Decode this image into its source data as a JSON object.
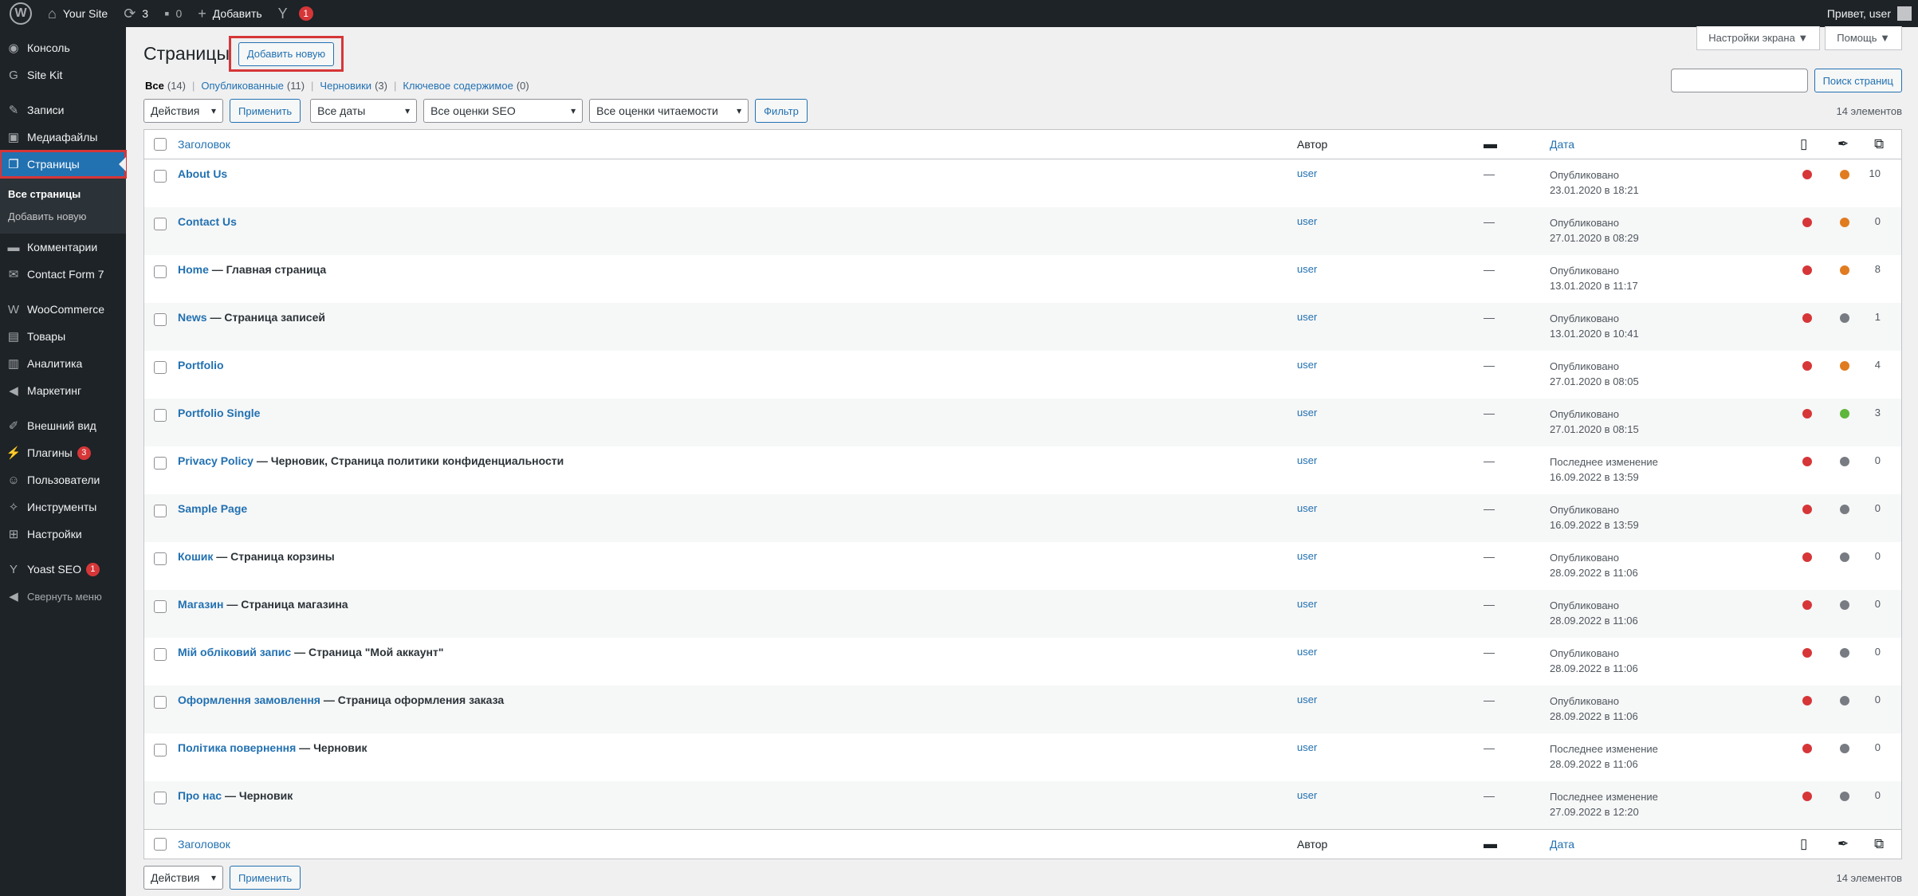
{
  "adminbar": {
    "wp_logo": "W",
    "site_name": "Your Site",
    "updates_count": "3",
    "comments_count": "0",
    "add_label": "Добавить",
    "yoast_badge": "1",
    "greeting": "Привет, user"
  },
  "sidebar": {
    "items": [
      {
        "label": "Консоль",
        "icon": "dashboard-icon"
      },
      {
        "label": "Site Kit",
        "icon": "sitekit-icon"
      },
      {
        "label": "Записи",
        "icon": "pushpin-icon"
      },
      {
        "label": "Медиафайлы",
        "icon": "media-icon"
      },
      {
        "label": "Страницы",
        "icon": "pages-icon"
      },
      {
        "label": "Комментарии",
        "icon": "comment-icon"
      },
      {
        "label": "Contact Form 7",
        "icon": "mail-icon"
      },
      {
        "label": "WooCommerce",
        "icon": "woo-icon"
      },
      {
        "label": "Товары",
        "icon": "archive-icon"
      },
      {
        "label": "Аналитика",
        "icon": "chart-icon"
      },
      {
        "label": "Маркетинг",
        "icon": "megaphone-icon"
      },
      {
        "label": "Внешний вид",
        "icon": "brush-icon"
      },
      {
        "label": "Плагины",
        "icon": "plugin-icon",
        "badge": "3"
      },
      {
        "label": "Пользователи",
        "icon": "users-icon"
      },
      {
        "label": "Инструменты",
        "icon": "tools-icon"
      },
      {
        "label": "Настройки",
        "icon": "settings-icon"
      },
      {
        "label": "Yoast SEO",
        "icon": "yoast-icon",
        "badge": "1"
      },
      {
        "label": "Свернуть меню",
        "icon": "collapse-icon"
      }
    ],
    "submenu": [
      "Все страницы",
      "Добавить новую"
    ]
  },
  "header": {
    "title": "Страницы",
    "add_new": "Добавить новую",
    "screen_options": "Настройки экрана ▼",
    "help": "Помощь ▼"
  },
  "filters": {
    "all": "Все",
    "all_count": "(14)",
    "published": "Опубликованные",
    "published_count": "(11)",
    "drafts": "Черновики",
    "drafts_count": "(3)",
    "cornerstone": "Ключевое содержимое",
    "cornerstone_count": "(0)",
    "search_button": "Поиск страниц",
    "bulk_action": "Действия",
    "apply": "Применить",
    "dates": "Все даты",
    "seo": "Все оценки SEO",
    "readability": "Все оценки читаемости",
    "filter": "Фильтр",
    "items_count": "14 элементов"
  },
  "table": {
    "col_title": "Заголовок",
    "col_author": "Автор",
    "col_date": "Дата",
    "colors": {
      "red": "#d63638",
      "orange": "#e07b20",
      "gray": "#787c82",
      "green": "#5eb63a"
    },
    "rows": [
      {
        "title": "About Us",
        "state": "",
        "author": "user",
        "comments": "—",
        "status": "Опубликовано",
        "date": "23.01.2020 в 18:21",
        "seo": "#d63638",
        "read": "#e07b20",
        "links": "10"
      },
      {
        "title": "Contact Us",
        "state": "",
        "author": "user",
        "comments": "—",
        "status": "Опубликовано",
        "date": "27.01.2020 в 08:29",
        "seo": "#d63638",
        "read": "#e07b20",
        "links": "0"
      },
      {
        "title": "Home",
        "state": " — Главная страница",
        "author": "user",
        "comments": "—",
        "status": "Опубликовано",
        "date": "13.01.2020 в 11:17",
        "seo": "#d63638",
        "read": "#e07b20",
        "links": "8"
      },
      {
        "title": "News",
        "state": " — Страница записей",
        "author": "user",
        "comments": "—",
        "status": "Опубликовано",
        "date": "13.01.2020 в 10:41",
        "seo": "#d63638",
        "read": "#787c82",
        "links": "1"
      },
      {
        "title": "Portfolio",
        "state": "",
        "author": "user",
        "comments": "—",
        "status": "Опубликовано",
        "date": "27.01.2020 в 08:05",
        "seo": "#d63638",
        "read": "#e07b20",
        "links": "4"
      },
      {
        "title": "Portfolio Single",
        "state": "",
        "author": "user",
        "comments": "—",
        "status": "Опубликовано",
        "date": "27.01.2020 в 08:15",
        "seo": "#d63638",
        "read": "#5eb63a",
        "links": "3"
      },
      {
        "title": "Privacy Policy",
        "state": " — Черновик, Страница политики конфиденциальности",
        "author": "user",
        "comments": "—",
        "status": "Последнее изменение",
        "date": "16.09.2022 в 13:59",
        "seo": "#d63638",
        "read": "#787c82",
        "links": "0"
      },
      {
        "title": "Sample Page",
        "state": "",
        "author": "user",
        "comments": "—",
        "status": "Опубликовано",
        "date": "16.09.2022 в 13:59",
        "seo": "#d63638",
        "read": "#787c82",
        "links": "0"
      },
      {
        "title": "Кошик",
        "state": " — Страница корзины",
        "author": "user",
        "comments": "—",
        "status": "Опубликовано",
        "date": "28.09.2022 в 11:06",
        "seo": "#d63638",
        "read": "#787c82",
        "links": "0"
      },
      {
        "title": "Магазин",
        "state": " — Страница магазина",
        "author": "user",
        "comments": "—",
        "status": "Опубликовано",
        "date": "28.09.2022 в 11:06",
        "seo": "#d63638",
        "read": "#787c82",
        "links": "0"
      },
      {
        "title": "Мій обліковий запис",
        "state": " — Страница \"Мой аккаунт\"",
        "author": "user",
        "comments": "—",
        "status": "Опубликовано",
        "date": "28.09.2022 в 11:06",
        "seo": "#d63638",
        "read": "#787c82",
        "links": "0"
      },
      {
        "title": "Оформлення замовлення",
        "state": " — Страница оформления заказа",
        "author": "user",
        "comments": "—",
        "status": "Опубликовано",
        "date": "28.09.2022 в 11:06",
        "seo": "#d63638",
        "read": "#787c82",
        "links": "0"
      },
      {
        "title": "Політика повернення",
        "state": " — Черновик",
        "author": "user",
        "comments": "—",
        "status": "Последнее изменение",
        "date": "28.09.2022 в 11:06",
        "seo": "#d63638",
        "read": "#787c82",
        "links": "0"
      },
      {
        "title": "Про нас",
        "state": " — Черновик",
        "author": "user",
        "comments": "—",
        "status": "Последнее изменение",
        "date": "27.09.2022 в 12:20",
        "seo": "#d63638",
        "read": "#787c82",
        "links": "0"
      }
    ]
  }
}
